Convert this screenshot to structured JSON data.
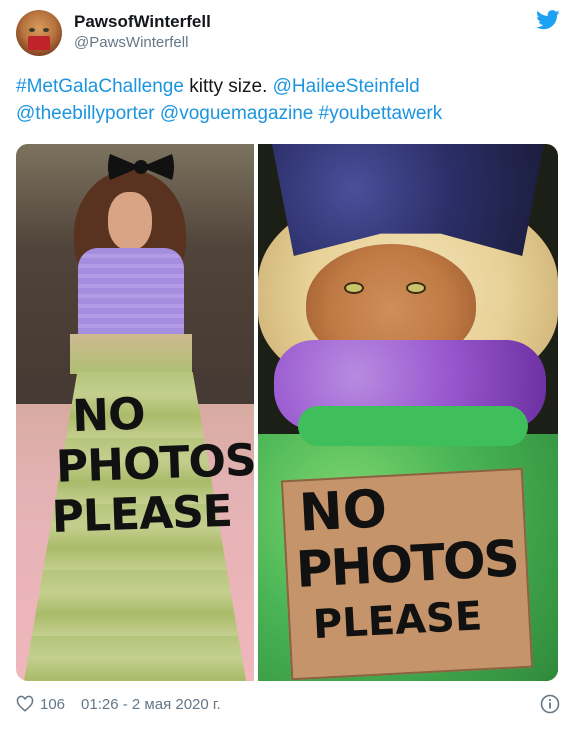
{
  "author": {
    "display_name": "PawsofWinterfell",
    "handle": "@PawsWinterfell",
    "avatar_icon": "avatar-cat",
    "brand_icon": "twitter-bird-icon"
  },
  "tweet": {
    "segments": [
      {
        "text": "#MetGalaChallenge",
        "link": true
      },
      {
        "text": " kitty size. ",
        "link": false
      },
      {
        "text": "@HaileeSteinfeld",
        "link": true
      },
      {
        "text": "@theebillyporter",
        "link": true
      },
      {
        "text": " ",
        "link": false
      },
      {
        "text": "@voguemagazine",
        "link": true
      },
      {
        "text": " ",
        "link": false
      },
      {
        "text": "#youbettawerk",
        "link": true
      }
    ]
  },
  "media": {
    "left_photo_text": [
      "NO",
      "PHOTOS",
      "PLEASE"
    ],
    "right_photo_text": [
      "NO",
      "PHOTOS",
      "PLEASE"
    ]
  },
  "footer": {
    "like_count": "106",
    "timestamp": "01:26 - 2 мая 2020 г."
  },
  "colors": {
    "link": "#1b95e0",
    "secondary_text": "#657786",
    "primary_text": "#14171a"
  }
}
